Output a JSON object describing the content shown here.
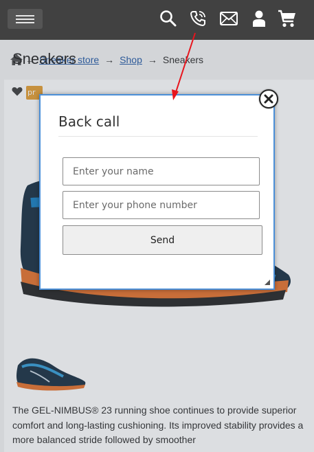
{
  "header": {
    "menu_icon": "hamburger-icon",
    "icons": [
      "search-icon",
      "phone-icon",
      "mail-icon",
      "user-icon",
      "cart-icon"
    ]
  },
  "breadcrumb": {
    "home_icon": "home-icon",
    "items": [
      "Sneaker store",
      "Shop"
    ],
    "current": "Sneakers",
    "separator": "→"
  },
  "product": {
    "title": "Sneakers",
    "badge": "pr",
    "description": "The GEL-NIMBUS® 23 running shoe continues to provide superior comfort and long-lasting cushioning. Its improved stability provides a more balanced stride followed by smoother"
  },
  "modal": {
    "title": "Back call",
    "name_placeholder": "Enter your name",
    "phone_placeholder": "Enter your phone number",
    "send_label": "Send"
  },
  "colors": {
    "header_bg": "#414141",
    "link": "#2a5fa8",
    "modal_border": "#4a8fd8",
    "annotation_arrow": "#e8141c"
  }
}
